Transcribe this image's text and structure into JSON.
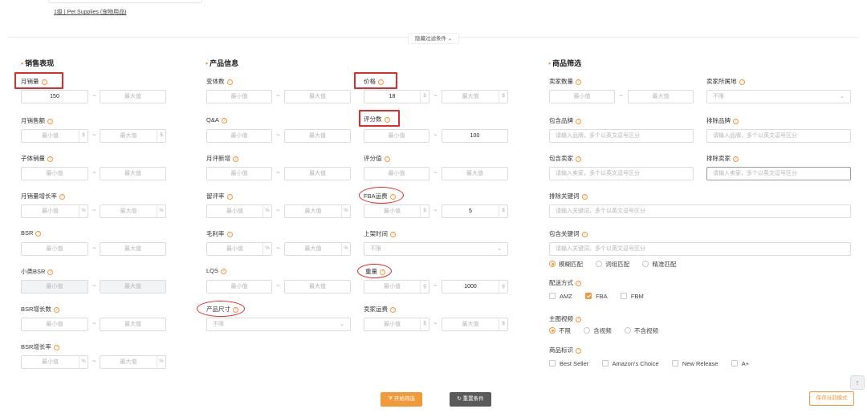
{
  "top": {
    "category_text": "1级 | Pet Supplies (宠物用品)",
    "hide_filters": "隐藏过滤条件"
  },
  "placeholders": {
    "min": "最小值",
    "max": "最大值",
    "unlimited": "不限",
    "brand_include": "请输入品牌，多个以英文逗号区分",
    "brand_exclude": "请输入品牌，多个以英文逗号区分",
    "seller_include": "请输入卖家，多个以英文逗号区分",
    "seller_exclude": "请输入卖家，多个以英文逗号区分",
    "keyword_exclude": "请输入关键词，多个以英文逗号区分",
    "keyword_include": "请输入关键词，多个以英文逗号区分"
  },
  "suffixes": {
    "percent": "%",
    "dollar": "$",
    "gram": "g"
  },
  "sales": {
    "title": "销售表现",
    "monthly_sales": "月销量",
    "monthly_sales_min": "150",
    "monthly_revenue": "月销售额",
    "child_sales": "子体销量",
    "sales_growth": "月销量增长率",
    "bsr": "BSR",
    "sub_bsr": "小类BSR",
    "bsr_growth_count": "BSR增长数",
    "bsr_growth_rate": "BSR增长率"
  },
  "product": {
    "title": "产品信息",
    "variants": "变体数",
    "qa": "Q&A",
    "monthly_new_reviews": "月评新增",
    "review_leave_rate": "留评率",
    "gross_margin": "毛利率",
    "lqs": "LQS",
    "size": "产品尺寸",
    "price": "价格",
    "price_min": "18",
    "review_count": "评分数",
    "review_count_max": "100",
    "rating": "评分值",
    "fba_fee": "FBA运费",
    "fba_fee_max": "5",
    "launch_time": "上架时间",
    "weight": "重量",
    "weight_max": "1000",
    "seller_shipping": "卖家运费"
  },
  "goods": {
    "title": "商品筛选",
    "seller_count": "卖家数量",
    "seller_location": "卖家所属地",
    "brand_include": "包含品牌",
    "brand_exclude": "排除品牌",
    "seller_include": "包含卖家",
    "seller_exclude": "排除卖家",
    "keyword_exclude": "排除关键词",
    "keyword_include": "包含关键词",
    "match_fuzzy": "模糊匹配",
    "match_phrase": "词组匹配",
    "match_exact": "精准匹配",
    "delivery": "配送方式",
    "amz": "AMZ",
    "fba": "FBA",
    "fbm": "FBM",
    "video": "主图视频",
    "video_any": "不限",
    "video_yes": "含视频",
    "video_no": "不含视频",
    "badges": "商品标识",
    "best_seller": "Best Seller",
    "amazons_choice": "Amazon's Choice",
    "new_release": "New Release",
    "aplus": "A+"
  },
  "actions": {
    "start": "开始筛选",
    "reset": "重置条件",
    "save": "保存当前模式"
  }
}
